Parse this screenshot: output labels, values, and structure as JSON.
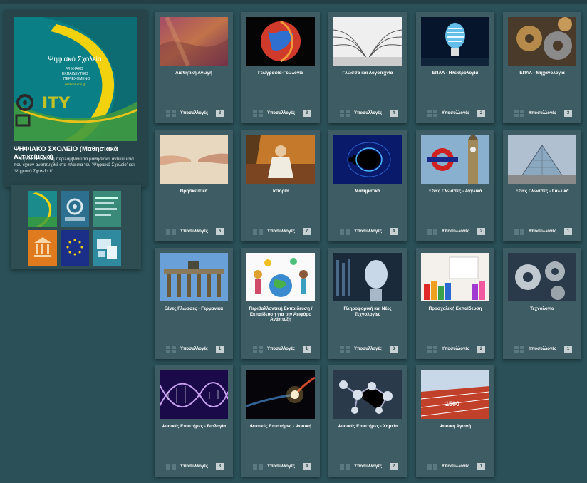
{
  "feature": {
    "title": "ΨΗΦΙΑΚΟ ΣΧΟΛΕΙΟ (Μαθησιακά Αντικείμενα)",
    "description": "Η παρούσα συλλογή περιλαμβάνει τα μαθησιακά αντικείμενα που έχουν αναπτυχθεί στα πλαίσια του 'Ψηφιακό Σχολείο' και 'Ψηφιακό Σχολείο ΙΙ'.",
    "logo_text": "Ψηφιακό Σχολείο",
    "logo_sub1": "ΨΗΦΙΑΚΟ",
    "logo_sub2": "ΕΚΠΑΙΔΕΥΤΙΚΟ",
    "logo_sub3": "ΠΕΡΙΕΧΟΜΕΝΟ",
    "logo_url": "dschool.edu.gr",
    "itu_text": "ITY"
  },
  "subcollections_label": "Υποσυλλογές",
  "cards": [
    {
      "title": "Αισθητική Αγωγή",
      "count": "3",
      "art": "paint"
    },
    {
      "title": "Γεωγραφία-Γεωλογία",
      "count": "3",
      "art": "globe"
    },
    {
      "title": "Γλώσσα και Λογοτεχνία",
      "count": "4",
      "art": "book"
    },
    {
      "title": "ΕΠΑΛ - Ηλεκτρολογία",
      "count": "2",
      "art": "bulb"
    },
    {
      "title": "ΕΠΑΛ - Μηχανολογία",
      "count": "3",
      "art": "gears"
    },
    {
      "title": "Θρησκευτικά",
      "count": "6",
      "art": "hands"
    },
    {
      "title": "Ιστορία",
      "count": "7",
      "art": "history"
    },
    {
      "title": "Μαθηματικά",
      "count": "4",
      "art": "fractal"
    },
    {
      "title": "Ξένες Γλώσσες - Αγγλικά",
      "count": "2",
      "art": "london"
    },
    {
      "title": "Ξένες Γλώσσες - Γαλλικά",
      "count": "1",
      "art": "louvre"
    },
    {
      "title": "Ξένες Γλώσσες - Γερμανικά",
      "count": "1",
      "art": "berlin"
    },
    {
      "title": "Περιβαλλοντική Εκπαίδευση / Εκπαίδευση για την Αειφόρο Ανάπτυξη",
      "count": "1",
      "art": "earth"
    },
    {
      "title": "Πληροφορική και Νέες Τεχνολογίες",
      "count": "3",
      "art": "robot"
    },
    {
      "title": "Προσχολική Εκπαίδευση",
      "count": "2",
      "art": "crayons"
    },
    {
      "title": "Τεχνολογία",
      "count": "1",
      "art": "cogs"
    },
    {
      "title": "Φυσικές Επιστήμες - Βιολογία",
      "count": "3",
      "art": "dna"
    },
    {
      "title": "Φυσικές Επιστήμες - Φυσική",
      "count": "4",
      "art": "comet"
    },
    {
      "title": "Φυσικές Επιστήμες - Χημεία",
      "count": "2",
      "art": "molecule"
    },
    {
      "title": "Φυσική Αγωγή",
      "count": "1",
      "art": "track"
    }
  ],
  "track_label": "1500"
}
